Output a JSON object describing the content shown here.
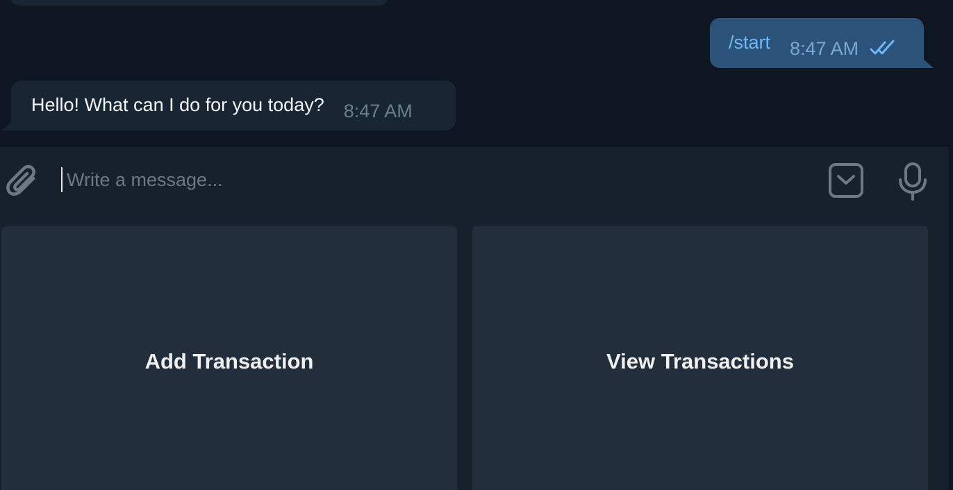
{
  "messages": [
    {
      "direction": "outgoing",
      "text": "/start",
      "time": "8:47 AM",
      "status": "read-double-check-icon"
    },
    {
      "direction": "incoming",
      "text": "Hello! What can I do for you today?",
      "time": "8:47 AM"
    }
  ],
  "composer": {
    "placeholder": "Write a message...",
    "attach_icon": "paperclip-icon",
    "keyboard_icon": "keyboard-toggle-icon",
    "mic_icon": "microphone-icon"
  },
  "keyboard": {
    "buttons": [
      {
        "label": "Add Transaction"
      },
      {
        "label": "View Transactions"
      }
    ]
  },
  "colors": {
    "background": "#0e1621",
    "incoming_bubble": "#182533",
    "outgoing_bubble": "#2b5278",
    "panel": "#17212b",
    "key": "#232e3c",
    "accent": "#71b7f5"
  }
}
